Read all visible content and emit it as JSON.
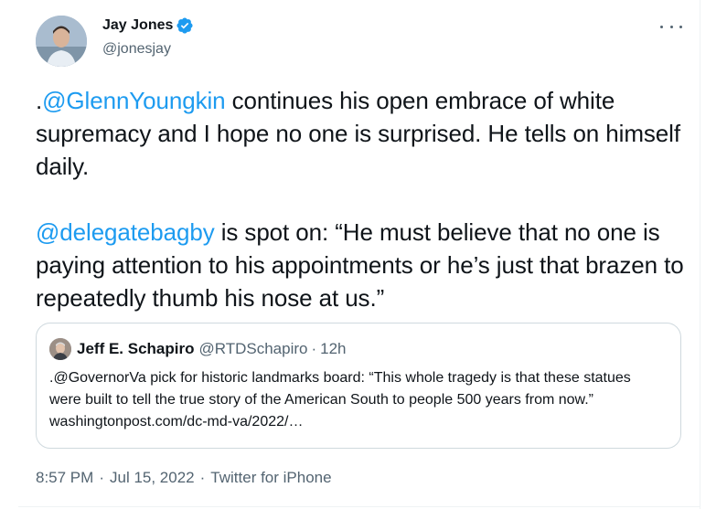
{
  "author": {
    "display_name": "Jay Jones",
    "handle": "@jonesjay",
    "verified": true
  },
  "menu": {
    "icon": "more-options-icon"
  },
  "tweet": {
    "p1_prefix": ".",
    "p1_mention": "@GlennYoungkin",
    "p1_rest": " continues his open embrace of white supremacy and I hope no one is surprised. He tells on himself daily.",
    "p2_mention": "@delegatebagby",
    "p2_rest": " is spot on: “He must believe that no one is paying attention to his appointments or he’s just that brazen to repeatedly thumb his nose at us.”"
  },
  "quote": {
    "display_name": "Jeff E. Schapiro",
    "handle": "@RTDSchapiro",
    "separator": "·",
    "time": "12h",
    "text": ".@GovernorVa pick for historic landmarks board: “This whole tragedy is that these statues were built to tell the true story of the American South to people 500 years from now.” washingtonpost.com/dc-md-va/2022/…"
  },
  "meta": {
    "time": "8:57 PM",
    "separator": "·",
    "date": "Jul 15, 2022",
    "source": "Twitter for iPhone"
  },
  "colors": {
    "link": "#1d9bf0",
    "text": "#0f1419",
    "secondary": "#536471",
    "border": "#cfd9de"
  }
}
